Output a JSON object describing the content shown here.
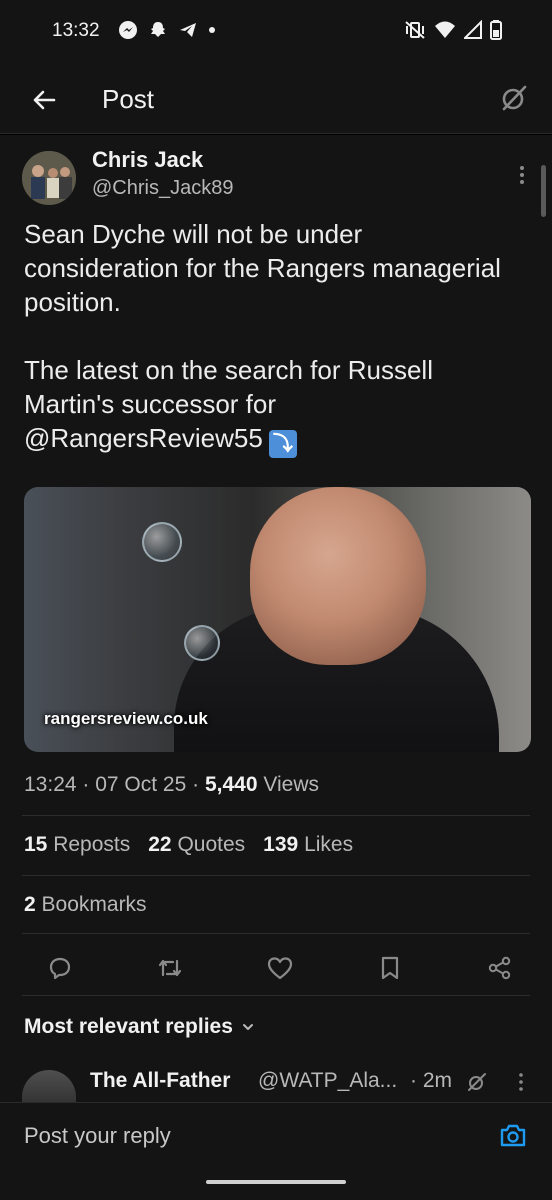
{
  "status_bar": {
    "time": "13:32",
    "left_icons": [
      "messenger-icon",
      "snapchat-icon",
      "telegram-icon",
      "dot-icon"
    ],
    "right_icons": [
      "vibrate-off-icon",
      "wifi-icon",
      "signal-icon",
      "battery-icon"
    ]
  },
  "header": {
    "title": "Post",
    "back_icon": "back-arrow-icon",
    "grok_icon": "grok-icon"
  },
  "post": {
    "author_name": "Chris Jack",
    "author_handle": "@Chris_Jack89",
    "text_line1": "Sean Dyche will not be under consideration for the Rangers managerial position.",
    "text_line2_prefix": "The latest on the search for Russell Martin's successor for",
    "mention": "@RangersReview55",
    "emoji": "⤵",
    "media_watermark": "rangersreview.co.uk",
    "time": "13:24",
    "date": "07 Oct 25",
    "views_count": "5,440",
    "views_label": "Views",
    "reposts_count": "15",
    "reposts_label": "Reposts",
    "quotes_count": "22",
    "quotes_label": "Quotes",
    "likes_count": "139",
    "likes_label": "Likes",
    "bookmarks_count": "2",
    "bookmarks_label": "Bookmarks"
  },
  "actions": [
    "reply-icon",
    "repost-icon",
    "like-icon",
    "bookmark-icon",
    "share-icon"
  ],
  "replies": {
    "sort_label": "Most relevant replies",
    "first_reply": {
      "name": "The All-Father",
      "handle": "@WATP_Ala...",
      "time": "· 2m"
    }
  },
  "reply_bar": {
    "placeholder": "Post your reply"
  },
  "colors": {
    "background": "#141414",
    "text": "#e7e9ea",
    "muted": "#b8b8b8",
    "accent": "#1d9bf0"
  }
}
